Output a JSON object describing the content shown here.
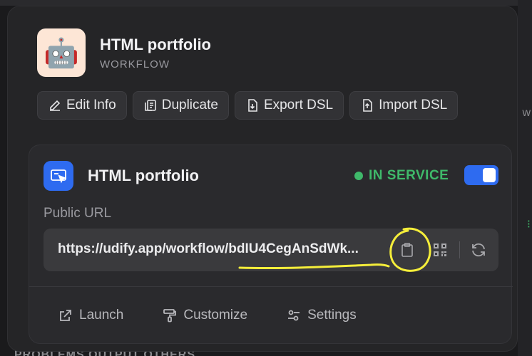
{
  "app": {
    "title": "HTML portfolio",
    "type": "WORKFLOW",
    "icon": "robot-emoji"
  },
  "actions": [
    {
      "label": "Edit Info",
      "icon": "pencil-icon"
    },
    {
      "label": "Duplicate",
      "icon": "copy-icon"
    },
    {
      "label": "Export DSL",
      "icon": "file-export-icon"
    },
    {
      "label": "Import DSL",
      "icon": "file-import-icon"
    }
  ],
  "card": {
    "title": "HTML portfolio",
    "icon": "window-cursor-icon",
    "status": "IN SERVICE",
    "toggle_on": true,
    "url_label": "Public URL",
    "url": "https://udify.app/workflow/bdIU4CegAnSdWk..."
  },
  "footer": [
    {
      "label": "Launch",
      "icon": "external-link-icon"
    },
    {
      "label": "Customize",
      "icon": "paint-roller-icon"
    },
    {
      "label": "Settings",
      "icon": "sliders-icon"
    }
  ],
  "background": {
    "bottom_text": "PROBLEMS    OUTPUT    OTHERS"
  },
  "colors": {
    "accent": "#2e6bf0",
    "status_green": "#3fb96a",
    "annotation": "#f5ee3a"
  }
}
